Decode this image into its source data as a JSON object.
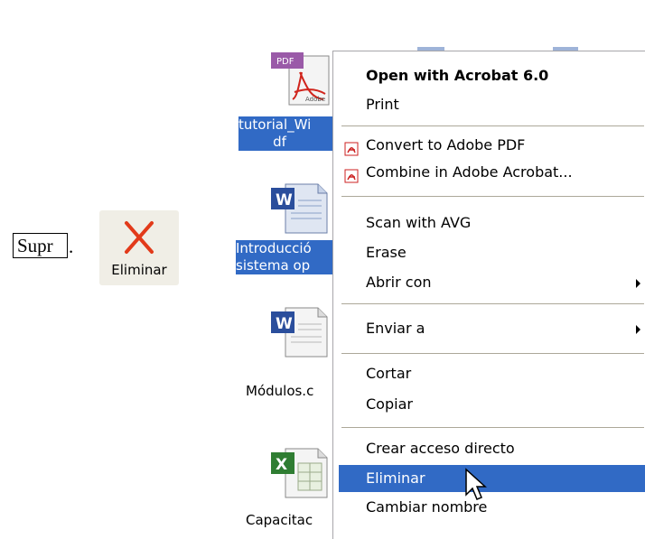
{
  "keyboard_hint": {
    "key": "Supr",
    "suffix": "."
  },
  "delete_button": {
    "label": "Eliminar"
  },
  "desktop": {
    "files": [
      {
        "name": "tutorial_Wi\n        df",
        "type": "pdf"
      },
      {
        "name": "Introducció\nsistema op",
        "type": "word"
      },
      {
        "name": "Módulos.c",
        "type": "word"
      },
      {
        "name": "Capacitac",
        "type": "excel"
      }
    ]
  },
  "context_menu": {
    "items": [
      {
        "label": "Open with Acrobat 6.0",
        "bold": true
      },
      {
        "label": "Print"
      },
      {
        "label": "Convert to Adobe PDF",
        "icon": "pdf-icon"
      },
      {
        "label": "Combine in Adobe Acrobat...",
        "icon": "pdf-icon"
      },
      {
        "label": "Scan with AVG"
      },
      {
        "label": "Erase"
      },
      {
        "label": "Abrir con",
        "submenu": true
      },
      {
        "label": "Enviar a",
        "submenu": true
      },
      {
        "label": "Cortar"
      },
      {
        "label": "Copiar"
      },
      {
        "label": "Crear acceso directo"
      },
      {
        "label": "Eliminar",
        "highlighted": true
      },
      {
        "label": "Cambiar nombre"
      }
    ]
  },
  "colors": {
    "selection": "#316ac5",
    "separator": "#aca899",
    "delete_red": "#e23a1a"
  }
}
